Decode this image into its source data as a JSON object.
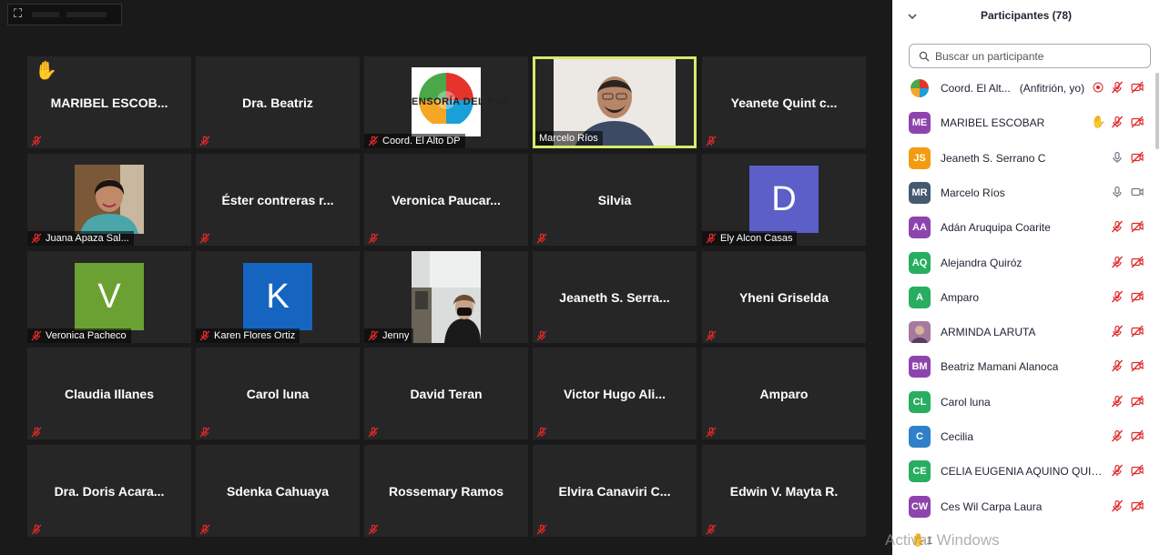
{
  "top_widget": {
    "glyph": "⛶"
  },
  "tiles": [
    {
      "name": "MARIBEL  ESCOB...",
      "type": "name",
      "hand": true
    },
    {
      "name": "Dra. Beatriz",
      "type": "name"
    },
    {
      "name": "Coord. El Alto DP",
      "type": "photo",
      "photo_kind": "logo",
      "logo_text": "ENSORÍA DEL PUE"
    },
    {
      "name": "Marcelo Ríos",
      "type": "photo",
      "photo_kind": "man",
      "active": true
    },
    {
      "name": "Yeanete  Quint  c...",
      "type": "name"
    },
    {
      "name": "Juana Apaza Sal...",
      "type": "photo",
      "photo_kind": "woman"
    },
    {
      "name": "Éster contreras  r...",
      "type": "name"
    },
    {
      "name": "Veronica  Paucar...",
      "type": "name"
    },
    {
      "name": "Silvia",
      "type": "name"
    },
    {
      "name": "Ely Alcon Casas",
      "type": "letter",
      "letter": "D",
      "color": "#5b5fc7"
    },
    {
      "name": "Veronica Pacheco",
      "type": "letter",
      "letter": "V",
      "color": "#6aa132"
    },
    {
      "name": "Karen Flores Ortiz",
      "type": "letter",
      "letter": "K",
      "color": "#1565c0"
    },
    {
      "name": "Jenny",
      "type": "photo",
      "photo_kind": "room"
    },
    {
      "name": "Jeaneth  S.  Serra...",
      "type": "name"
    },
    {
      "name": "Yheni Griselda",
      "type": "name"
    },
    {
      "name": "Claudia Illanes",
      "type": "name"
    },
    {
      "name": "Carol luna",
      "type": "name"
    },
    {
      "name": "David Teran",
      "type": "name"
    },
    {
      "name": "Victor  Hugo  Ali...",
      "type": "name"
    },
    {
      "name": "Amparo",
      "type": "name"
    },
    {
      "name": "Dra.  Doris  Acara...",
      "type": "name"
    },
    {
      "name": "Sdenka Cahuaya",
      "type": "name"
    },
    {
      "name": "Rossemary Ramos",
      "type": "name"
    },
    {
      "name": "Elvira  Canaviri  C...",
      "type": "name"
    },
    {
      "name": "Edwin V. Mayta R.",
      "type": "name"
    }
  ],
  "panel": {
    "title": "Participantes (78)",
    "search_placeholder": "Buscar un participante",
    "participants": [
      {
        "initials": "",
        "name": "Coord. El Alt...",
        "note": "(Anfitrión, yo)",
        "color": "logo",
        "mic": "muted",
        "cam": "off",
        "extra": "record"
      },
      {
        "initials": "ME",
        "name": "MARIBEL ESCOBAR",
        "color": "#8e44ad",
        "mic": "muted",
        "cam": "off",
        "hand": true
      },
      {
        "initials": "JS",
        "name": "Jeaneth S. Serrano C",
        "color": "#f39c12",
        "mic": "on",
        "cam": "off"
      },
      {
        "initials": "MR",
        "name": "Marcelo Ríos",
        "color": "#455a6f",
        "mic": "on",
        "cam": "on"
      },
      {
        "initials": "AA",
        "name": "Adán Aruquipa Coarite",
        "color": "#8e44ad",
        "mic": "muted",
        "cam": "off"
      },
      {
        "initials": "AQ",
        "name": "Alejandra Quiróz",
        "color": "#27ae60",
        "mic": "muted",
        "cam": "off"
      },
      {
        "initials": "A",
        "name": "Amparo",
        "color": "#27ae60",
        "mic": "muted",
        "cam": "off"
      },
      {
        "initials": "",
        "name": "ARMINDA LARUTA",
        "color": "photo",
        "mic": "muted",
        "cam": "off"
      },
      {
        "initials": "BM",
        "name": "Beatriz Mamani Alanoca",
        "color": "#8e44ad",
        "mic": "muted",
        "cam": "off"
      },
      {
        "initials": "CL",
        "name": "Carol luna",
        "color": "#27ae60",
        "mic": "muted",
        "cam": "off"
      },
      {
        "initials": "C",
        "name": "Cecilia",
        "color": "#2f80c8",
        "mic": "muted",
        "cam": "off"
      },
      {
        "initials": "CE",
        "name": "CELIA EUGENIA AQUINO QUISB...",
        "color": "#27ae60",
        "mic": "muted",
        "cam": "off"
      },
      {
        "initials": "CW",
        "name": "Ces Wil Carpa Laura",
        "color": "#8e44ad",
        "mic": "muted",
        "cam": "off"
      }
    ],
    "bottom_count": "1"
  },
  "watermark": "Activar Windows",
  "colors": {
    "mute_red": "#e02828",
    "active_border": "#d6e96a",
    "tile_bg": "#262626"
  }
}
